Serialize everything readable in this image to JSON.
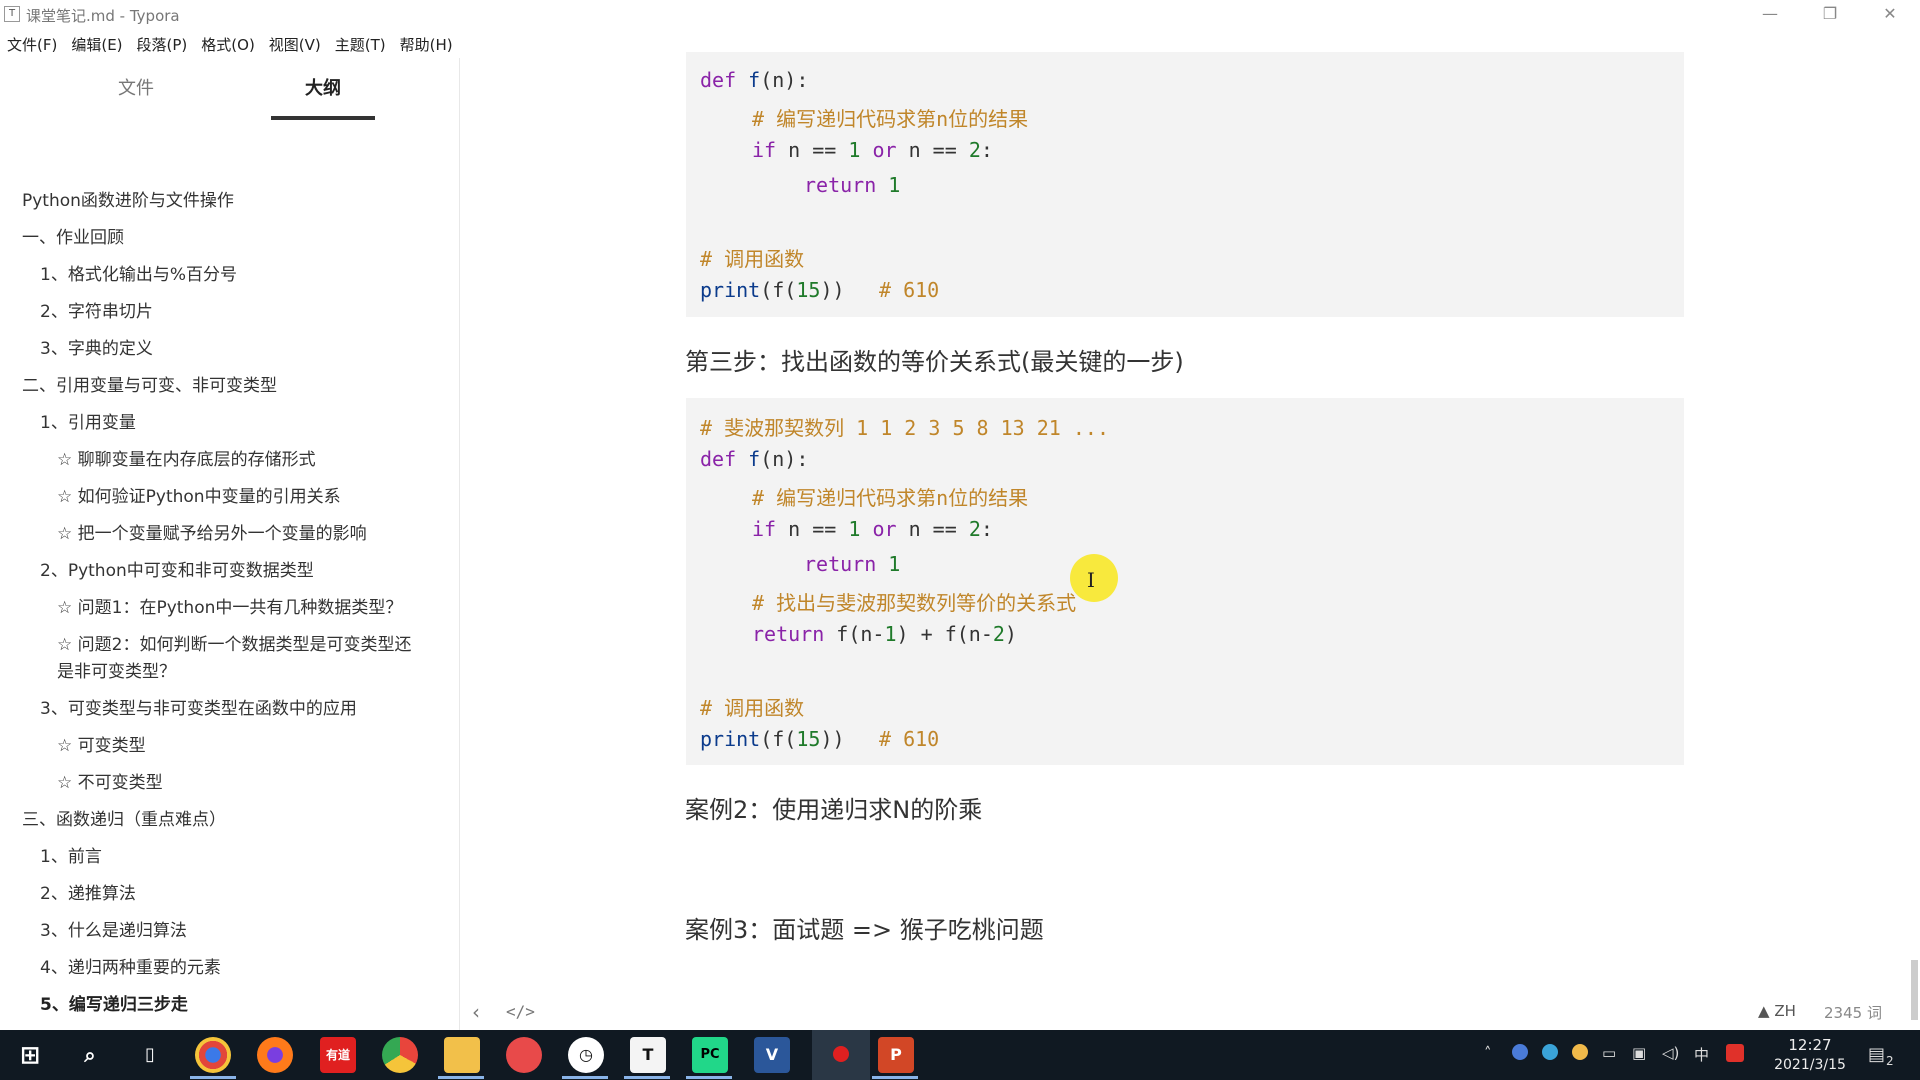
{
  "window": {
    "title": "课堂笔记.md - Typora",
    "app_icon": "T",
    "min": "—",
    "restore": "❐",
    "close": "✕"
  },
  "menubar": [
    "文件(F)",
    "编辑(E)",
    "段落(P)",
    "格式(O)",
    "视图(V)",
    "主题(T)",
    "帮助(H)"
  ],
  "sidebar": {
    "tabs": [
      "文件",
      "大纲"
    ],
    "outline": [
      {
        "text": "Python函数进阶与文件操作",
        "level": 0
      },
      {
        "text": "一、作业回顾",
        "level": 0
      },
      {
        "text": "1、格式化输出与%百分号",
        "level": 1
      },
      {
        "text": "2、字符串切片",
        "level": 1
      },
      {
        "text": "3、字典的定义",
        "level": 1
      },
      {
        "text": "二、引用变量与可变、非可变类型",
        "level": 0
      },
      {
        "text": "1、引用变量",
        "level": 1
      },
      {
        "text": "☆ 聊聊变量在内存底层的存储形式",
        "level": 2
      },
      {
        "text": "☆ 如何验证Python中变量的引用关系",
        "level": 2
      },
      {
        "text": "☆ 把一个变量赋予给另外一个变量的影响",
        "level": 2
      },
      {
        "text": "2、Python中可变和非可变数据类型",
        "level": 1
      },
      {
        "text": "☆ 问题1：在Python中一共有几种数据类型？",
        "level": 2
      },
      {
        "text": "☆ 问题2：如何判断一个数据类型是可变类型还是非可变类型？",
        "level": 2
      },
      {
        "text": "3、可变类型与非可变类型在函数中的应用",
        "level": 1
      },
      {
        "text": "☆ 可变类型",
        "level": 2
      },
      {
        "text": "☆ 不可变类型",
        "level": 2
      },
      {
        "text": "三、函数递归（重点难点）",
        "level": 0
      },
      {
        "text": "1、前言",
        "level": 1
      },
      {
        "text": "2、递推算法",
        "level": 1
      },
      {
        "text": "3、什么是递归算法",
        "level": 1
      },
      {
        "text": "4、递归两种重要的元素",
        "level": 1
      },
      {
        "text": "5、编写递归三步走",
        "level": 1,
        "active": true
      }
    ]
  },
  "content": {
    "code1": {
      "comment_impl": "# 编写递归代码求第n位的结果",
      "comment_call": "# 调用函数",
      "comment_result": "# 610"
    },
    "heading_step3": "第三步：找出函数的等价关系式(最关键的一步)",
    "code2": {
      "comment_seq": "# 斐波那契数列 1 1 2 3 5 8 13 21 ...",
      "comment_impl": "# 编写递归代码求第n位的结果",
      "comment_relation": "# 找出与斐波那契数列等价的关系式",
      "comment_call": "# 调用函数",
      "comment_result": "# 610"
    },
    "heading_case2": "案例2：使用递归求N的阶乘",
    "heading_case3": "案例3：面试题 => 猴子吃桃问题"
  },
  "footer": {
    "lang": "ZH",
    "word_count": "2345 词"
  },
  "taskbar": {
    "apps": [
      "start-icon",
      "search-icon",
      "task-view-icon",
      "chrome-icon",
      "firefox-icon",
      "youdao-icon",
      "chromium-icon",
      "file-explorer-icon",
      "screen-recorder-icon",
      "clock-app-icon",
      "typora-icon",
      "pycharm-icon",
      "visio-icon",
      "record-icon",
      "powerpoint-icon"
    ],
    "youdao_label": "有道",
    "time": "12:27",
    "date": "2021/3/15",
    "ime": "中",
    "notifications": "2"
  }
}
